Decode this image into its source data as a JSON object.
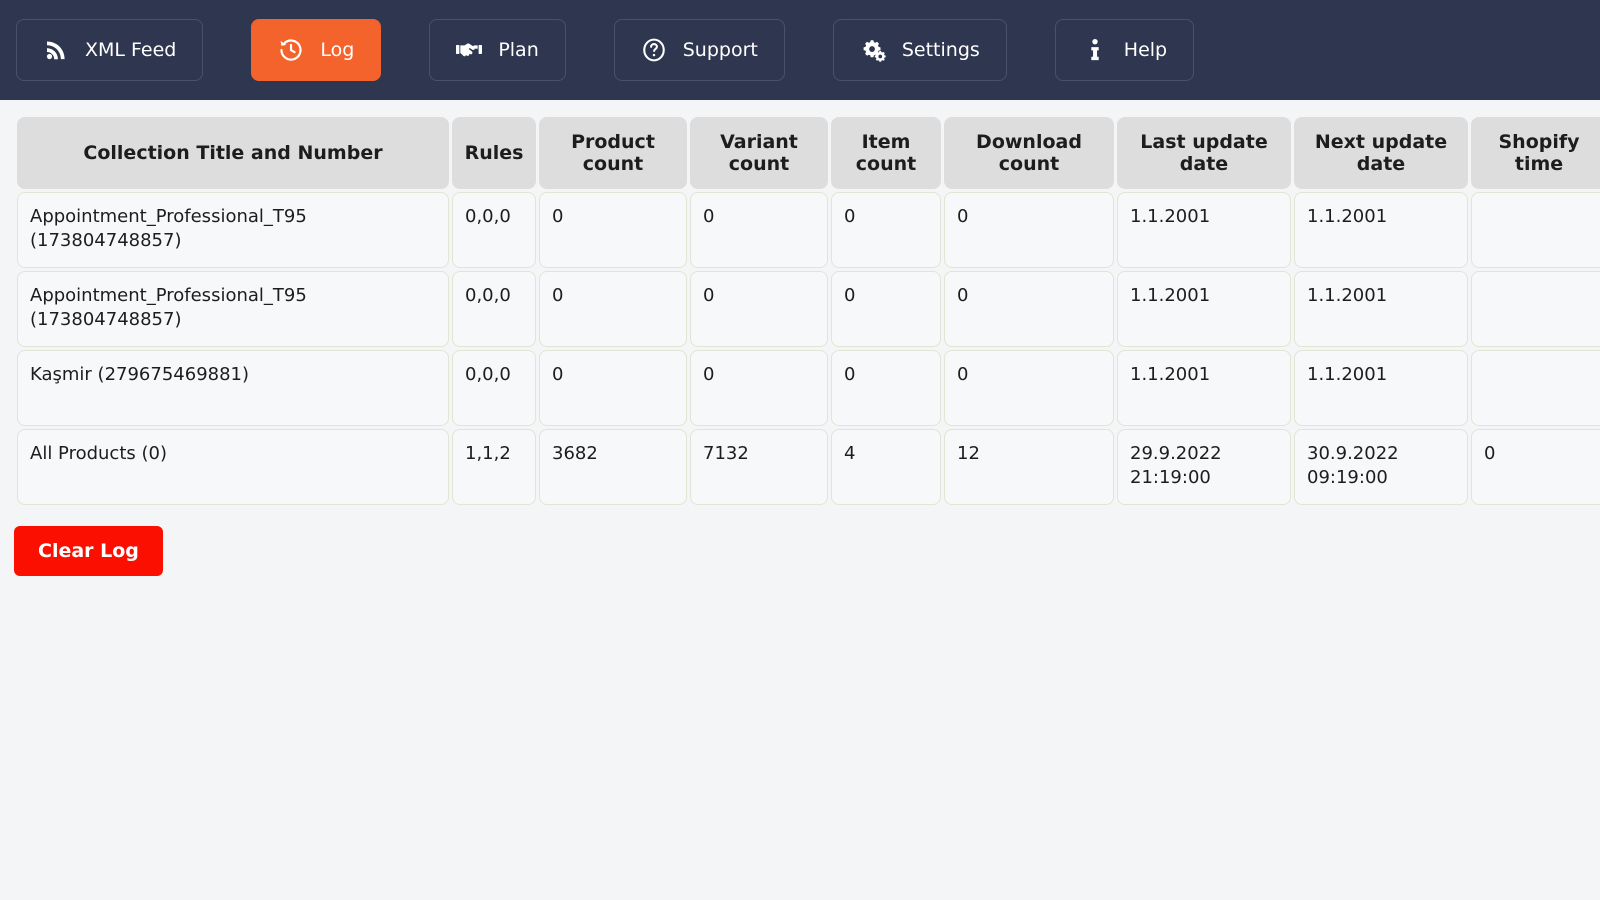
{
  "nav": {
    "items": [
      {
        "label": "XML Feed",
        "icon": "rss-icon",
        "active": false
      },
      {
        "label": "Log",
        "icon": "history-icon",
        "active": true
      },
      {
        "label": "Plan",
        "icon": "handshake-icon",
        "active": false
      },
      {
        "label": "Support",
        "icon": "question-circle-icon",
        "active": false
      },
      {
        "label": "Settings",
        "icon": "gears-icon",
        "active": false
      },
      {
        "label": "Help",
        "icon": "info-icon",
        "active": false
      }
    ],
    "active_color": "#f4632c",
    "bar_color": "#2f3650"
  },
  "table": {
    "headers": [
      "Collection Title and Number",
      "Rules",
      "Product count",
      "Variant count",
      "Item count",
      "Download count",
      "Last update date",
      "Next update date",
      "Shopify time",
      ""
    ],
    "rows": [
      {
        "title": "Appointment_Professional_T95 (173804748857)",
        "rules": "0,0,0",
        "product_count": "0",
        "variant_count": "0",
        "item_count": "0",
        "download_count": "0",
        "last_update_date": "1.1.2001",
        "next_update_date": "1.1.2001",
        "shopify_time": "",
        "extra": ""
      },
      {
        "title": "Appointment_Professional_T95 (173804748857)",
        "rules": "0,0,0",
        "product_count": "0",
        "variant_count": "0",
        "item_count": "0",
        "download_count": "0",
        "last_update_date": "1.1.2001",
        "next_update_date": "1.1.2001",
        "shopify_time": "",
        "extra": ""
      },
      {
        "title": "Kaşmir (279675469881)",
        "rules": "0,0,0",
        "product_count": "0",
        "variant_count": "0",
        "item_count": "0",
        "download_count": "0",
        "last_update_date": "1.1.2001",
        "next_update_date": "1.1.2001",
        "shopify_time": "",
        "extra": ""
      },
      {
        "title": "All Products (0)",
        "rules": "1,1,2",
        "product_count": "3682",
        "variant_count": "7132",
        "item_count": "4",
        "download_count": "12",
        "last_update_date": "29.9.2022 21:19:00",
        "next_update_date": "30.9.2022 09:19:00",
        "shopify_time": "0",
        "extra": ""
      }
    ]
  },
  "actions": {
    "clear_log_label": "Clear Log",
    "clear_log_color": "#fa0f00"
  }
}
